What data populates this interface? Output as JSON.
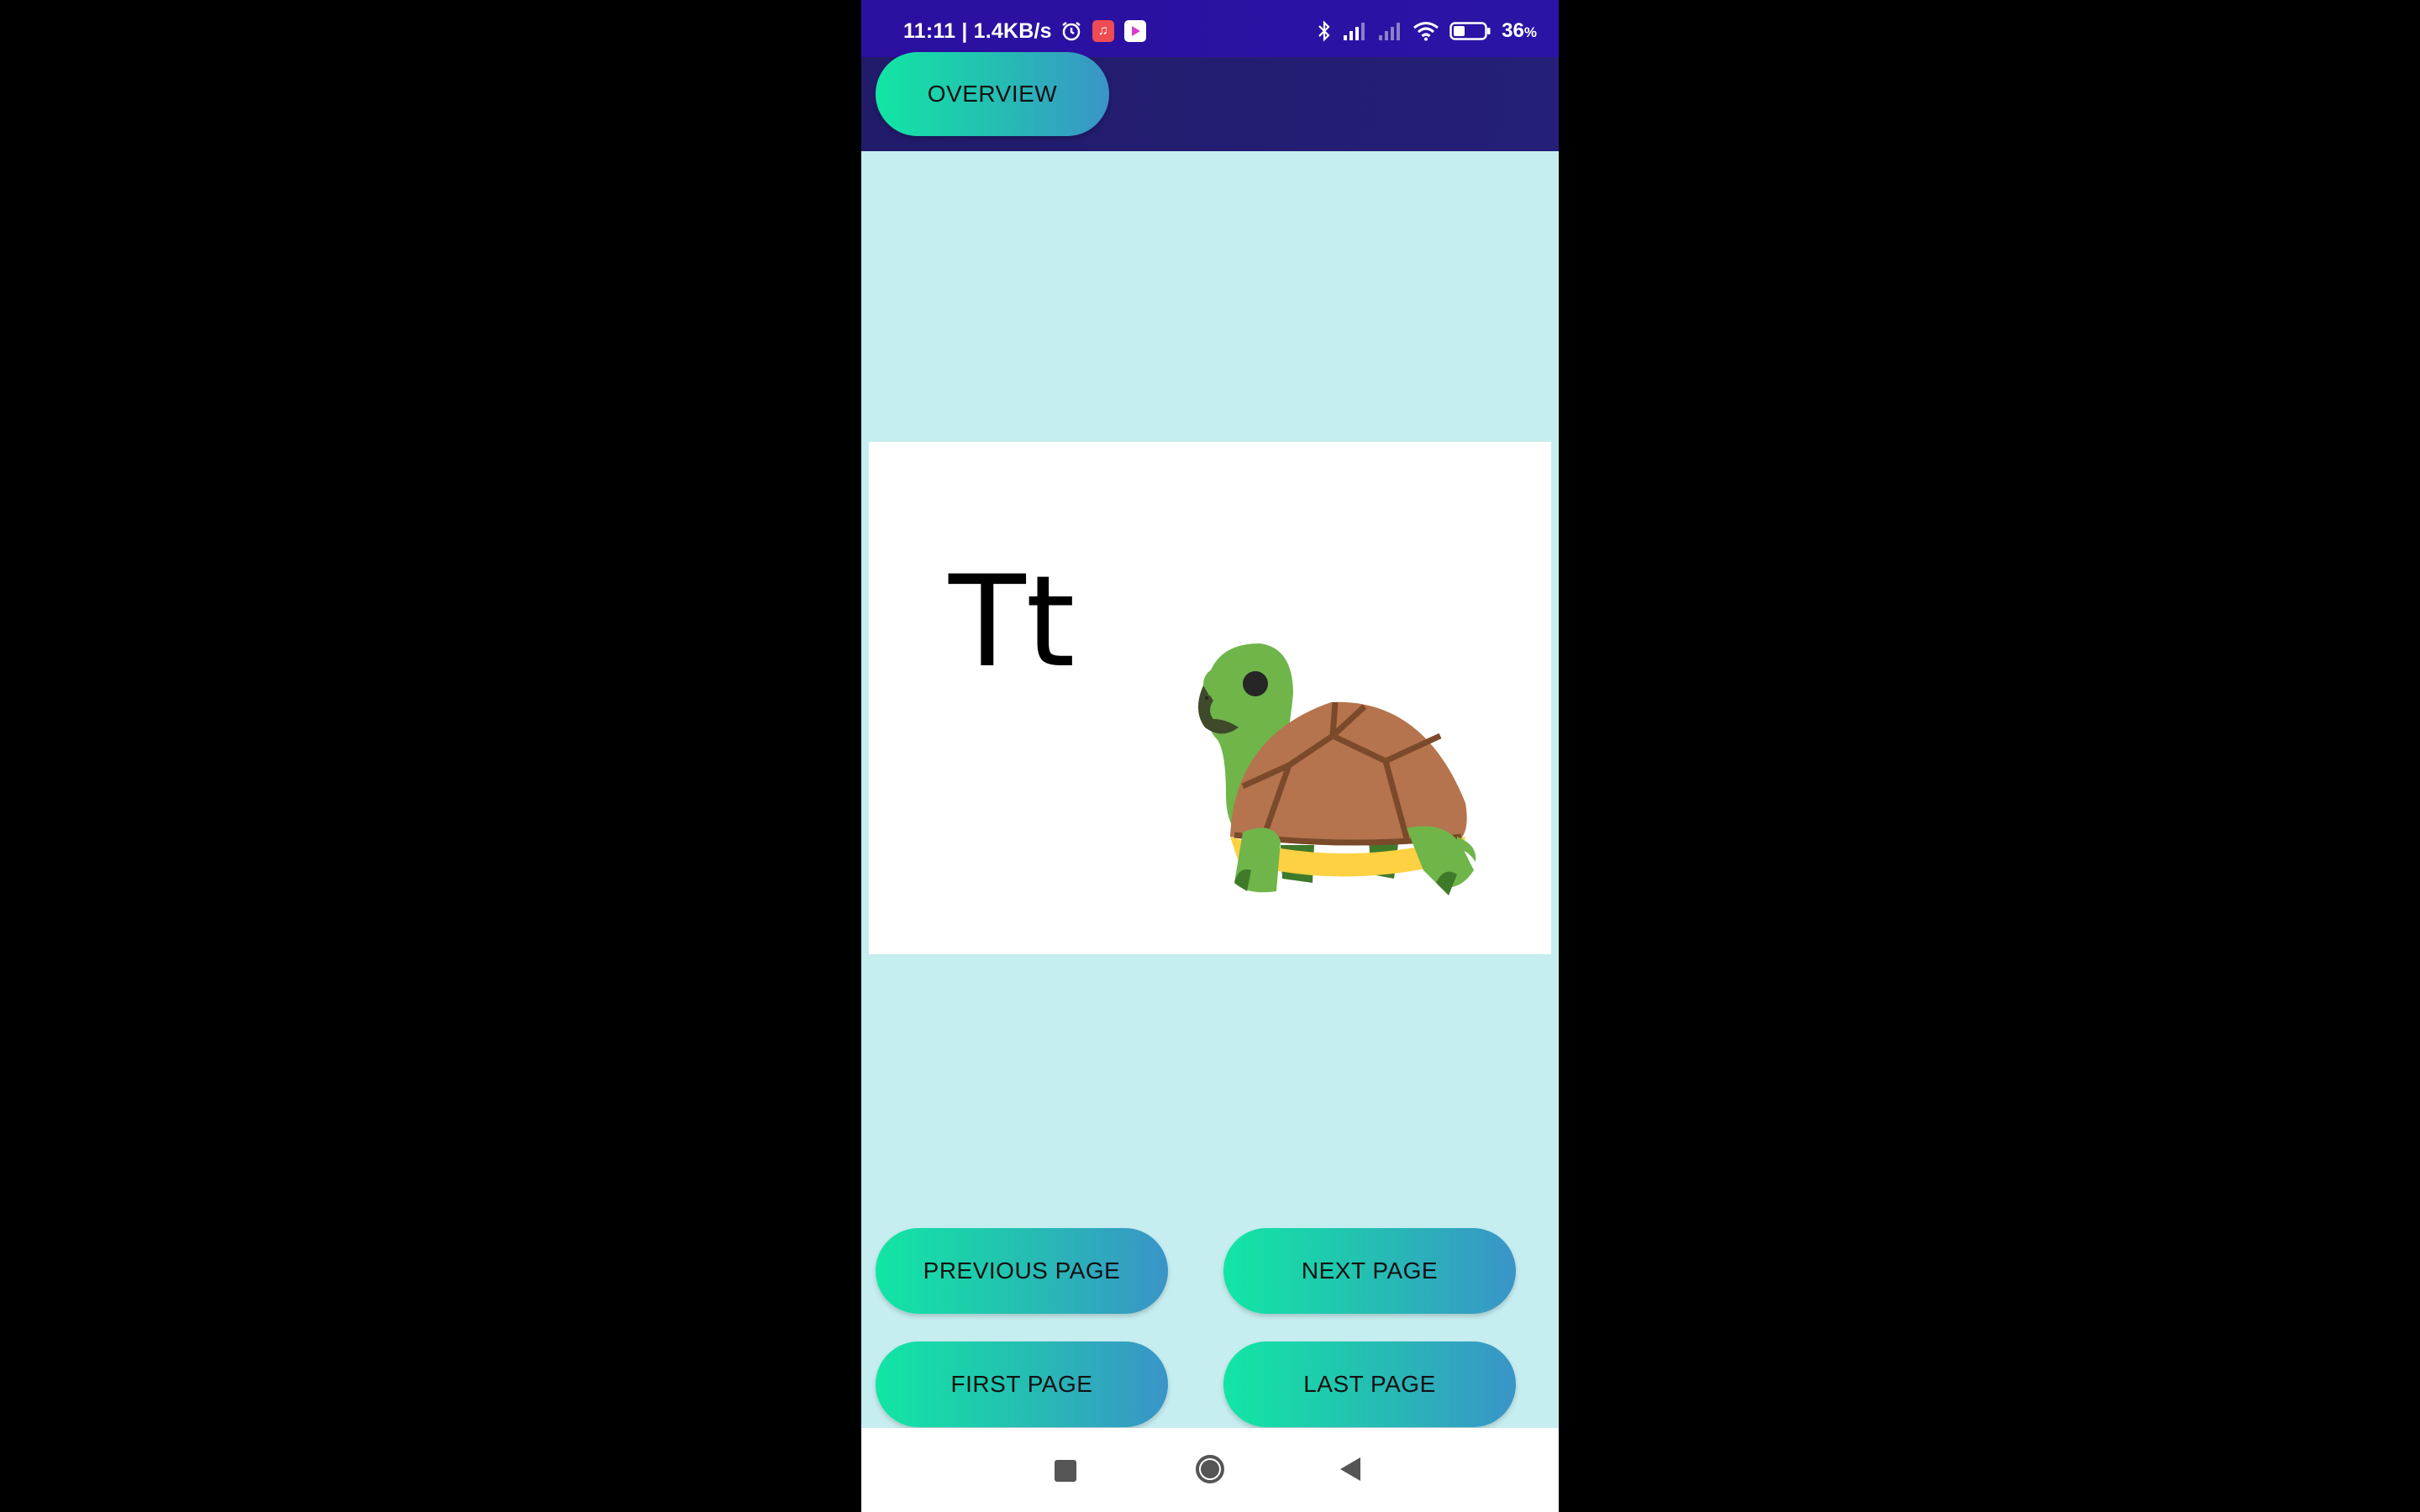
{
  "status_bar": {
    "time_speed": "11:11 | 1.4KB/s",
    "battery_percent": "36",
    "battery_unit": "%",
    "battery_level": 0.36,
    "icons": [
      "alarm-icon",
      "music-app-icon",
      "play-app-icon",
      "bluetooth-icon",
      "signal-icon",
      "signal-weak-icon",
      "wifi-icon",
      "battery-icon"
    ]
  },
  "header": {
    "overview_label": "OVERVIEW"
  },
  "card": {
    "letter": "Tt",
    "image_icon": "turtle-icon"
  },
  "navigation": {
    "previous_label": "PREVIOUS PAGE",
    "next_label": "NEXT PAGE",
    "first_label": "FIRST PAGE",
    "last_label": "LAST PAGE"
  },
  "system_nav": {
    "icons": [
      "recent-apps-icon",
      "home-icon",
      "back-icon"
    ]
  },
  "colors": {
    "status_bar": "#2b0fa0",
    "top_bar": "#221b6a",
    "background": "#c6eef0",
    "button_gradient_start": "#12e6a4",
    "button_gradient_end": "#3a94c8",
    "turtle_shell": "#b5744e",
    "turtle_skin": "#6fb54a",
    "turtle_belly": "#fdd141"
  }
}
